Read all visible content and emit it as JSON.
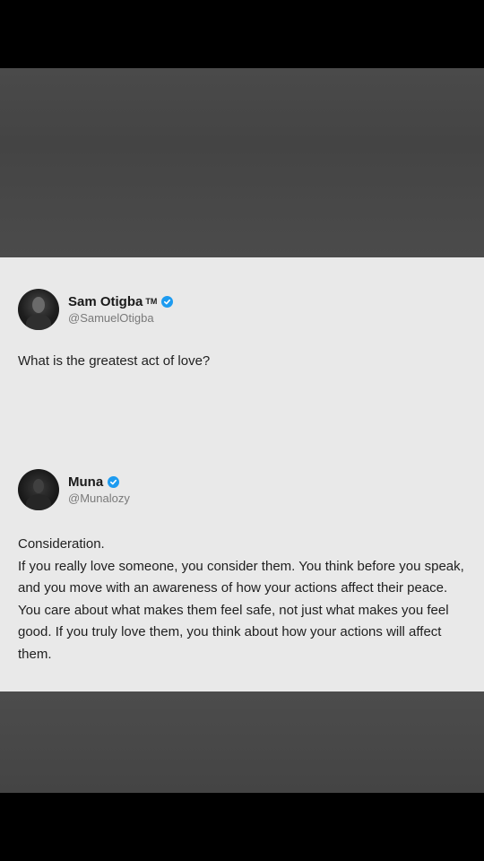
{
  "post_1": {
    "name": "Sam Otigba",
    "name_suffix": "TM",
    "handle": "@SamuelOtigba",
    "verified": true,
    "text": "What is the greatest act of love?"
  },
  "post_2": {
    "name": "Muna",
    "handle": "@Munalozy",
    "verified": true,
    "lines": [
      "Consideration.",
      "If you really love someone, you consider them. You think before you speak, and you move with an awareness of how your actions affect their peace. You care about what makes them feel safe, not just what makes you feel good. If you truly love them, you think about how your actions will affect them."
    ]
  },
  "colors": {
    "verified_badge": "#1d9bf0",
    "card_background": "#e9e9e9",
    "frame_grey": "#474747",
    "letterbox": "#000000"
  },
  "icons": {
    "verified": "verified-badge-icon",
    "avatar_1": "profile-photo-man",
    "avatar_2": "profile-photo-dark"
  }
}
